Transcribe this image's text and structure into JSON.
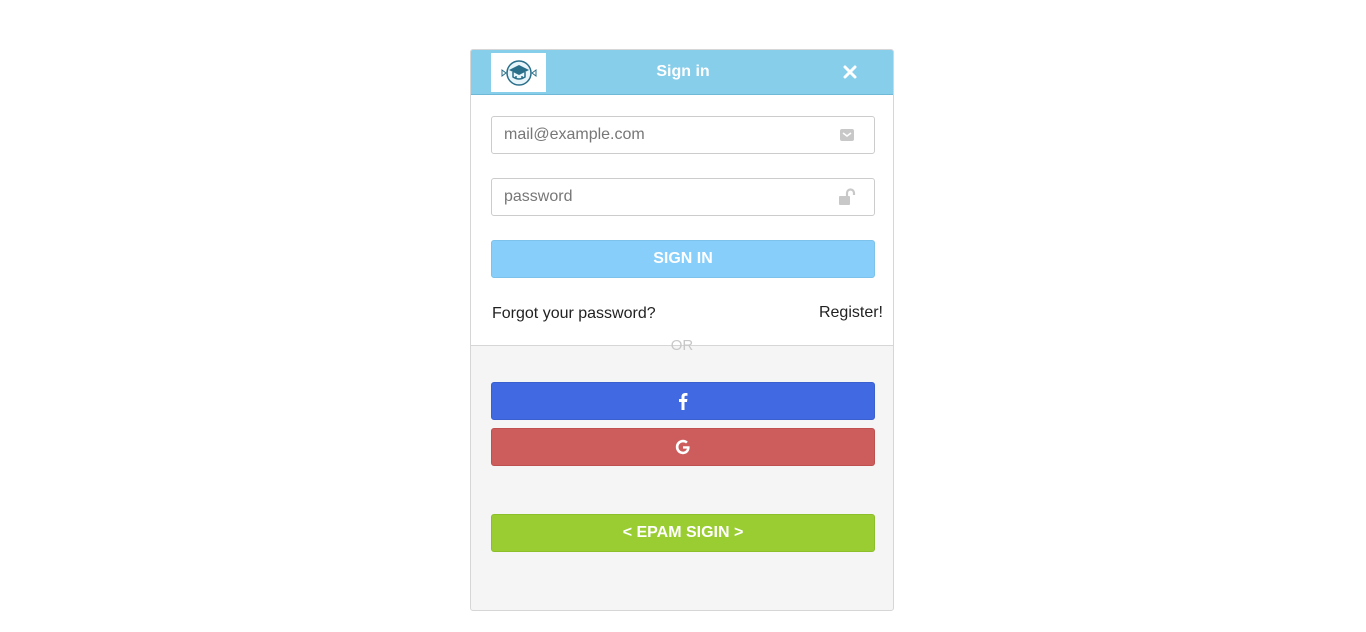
{
  "header": {
    "title": "Sign in"
  },
  "form": {
    "email_placeholder": "mail@example.com",
    "email_value": "",
    "password_placeholder": "password",
    "password_value": "",
    "signin_label": "SIGN IN"
  },
  "links": {
    "forgot": "Forgot your password?",
    "register": "Register!"
  },
  "divider": {
    "or_label": "OR"
  },
  "social": {
    "facebook_icon": "facebook-icon",
    "google_icon": "google-icon",
    "epam_label": "< EPAM SIGIN >"
  },
  "colors": {
    "header": "#87ceeb",
    "signin": "#87cefa",
    "facebook": "#4169e1",
    "google": "#cd5c5c",
    "epam": "#9acd32"
  }
}
